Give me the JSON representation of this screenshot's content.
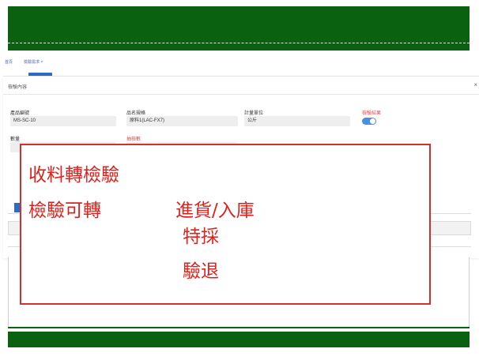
{
  "breadcrumb": {
    "items": [
      "首頁",
      "檢驗需求 ×"
    ]
  },
  "modal": {
    "title": "檢驗內容",
    "close_glyph": "×",
    "fields": {
      "product_code": {
        "label": "產品編號",
        "value": "MS-SC-10"
      },
      "product_name": {
        "label": "品名規格",
        "value": "原料1(LAC-FX7)"
      },
      "unit": {
        "label": "計量單位",
        "value": "公斤"
      },
      "inspection_result": {
        "label": "檢驗結果",
        "toggle_on": true
      },
      "quantity": {
        "label": "數量"
      },
      "sample_quantity": {
        "label": "抽檢數"
      }
    }
  },
  "overlay": {
    "line1": "收料轉檢驗",
    "line2_left": "檢驗可轉",
    "option1": "進貨/入庫",
    "option2": "特採",
    "option3": "驗退"
  },
  "colors": {
    "band_green": "#0a6110",
    "overlay_red": "#e0201c",
    "toggle_blue": "#4c8ee0",
    "link_blue": "#2d6cc0"
  }
}
